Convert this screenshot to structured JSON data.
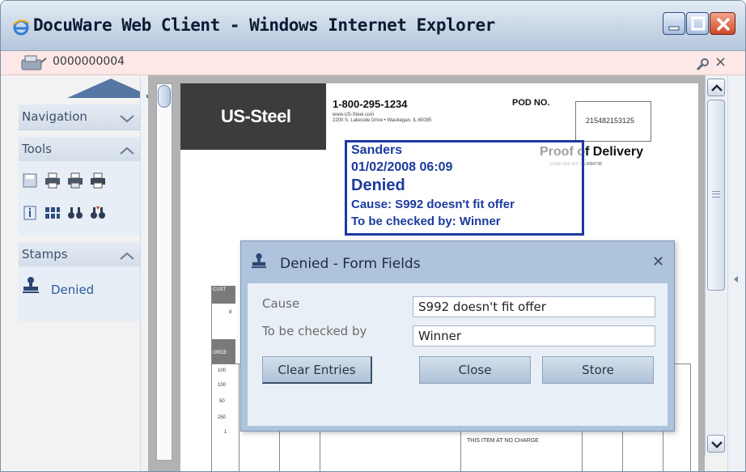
{
  "window": {
    "title": "DocuWare Web Client - Windows Internet Explorer"
  },
  "docbar": {
    "document_id": "0000000004"
  },
  "sidebar": {
    "sections": [
      {
        "label": "Navigation",
        "state": "collapsed"
      },
      {
        "label": "Tools",
        "state": "expanded"
      },
      {
        "label": "Stamps",
        "state": "expanded"
      }
    ],
    "tools": [
      "save-icon",
      "print-icon",
      "print-preview-icon",
      "print-all-icon",
      "info-icon",
      "thumbnails-icon",
      "find-icon",
      "find-next-icon"
    ],
    "stamps": [
      {
        "label": "Denied",
        "icon": "stamp-icon"
      }
    ]
  },
  "document": {
    "logo": "US-Steel",
    "phone": "1-800-295-1234",
    "website": "www.US-Steel.com",
    "address": "2200 S. Lakeside Drive • Waukegan, IL 60085",
    "pod_label": "POD NO.",
    "pod_number": "215482153125",
    "title": "Proof of Delivery",
    "subtitle": "ULINE FED ID#: 36-3684738",
    "no_charge_note": "THIS ITEM AT NO CHARGE",
    "table_labels": [
      "CUST",
      "ORDE"
    ],
    "table_values": [
      "8",
      "100",
      "100",
      "50",
      "250",
      "1"
    ]
  },
  "stamp": {
    "name": "Sanders",
    "datetime": "01/02/2008 06:09",
    "status": "Denied",
    "cause_line": "Cause: S992 doesn't fit offer",
    "check_line": "To be checked by: Winner",
    "color": "#1c3a9e"
  },
  "dialog": {
    "title": "Denied - Form Fields",
    "fields": [
      {
        "label": "Cause",
        "value": "S992 doesn't fit offer"
      },
      {
        "label": "To be checked by",
        "value": "Winner"
      }
    ],
    "buttons": {
      "clear": "Clear Entries",
      "close": "Close",
      "store": "Store"
    }
  },
  "colors": {
    "accent": "#5577a4",
    "dialog_header": "#aec3dc",
    "docbar_bg": "#fde7e7"
  }
}
